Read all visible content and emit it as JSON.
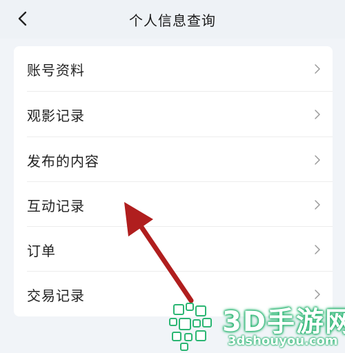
{
  "header": {
    "back_icon": "chevron-left-icon",
    "title": "个人信息查询"
  },
  "menu": {
    "items": [
      {
        "label": "账号资料",
        "icon": "chevron-right-icon"
      },
      {
        "label": "观影记录",
        "icon": "chevron-right-icon"
      },
      {
        "label": "发布的内容",
        "icon": "chevron-right-icon"
      },
      {
        "label": "互动记录",
        "icon": "chevron-right-icon"
      },
      {
        "label": "订单",
        "icon": "chevron-right-icon"
      },
      {
        "label": "交易记录",
        "icon": "chevron-right-icon"
      }
    ]
  },
  "annotation": {
    "arrow_color": "#b01e1e",
    "points_to": "互动记录"
  },
  "watermark": {
    "brand": "3D手游网",
    "domain": "3dshouyou.com",
    "color": "#2bb673"
  }
}
